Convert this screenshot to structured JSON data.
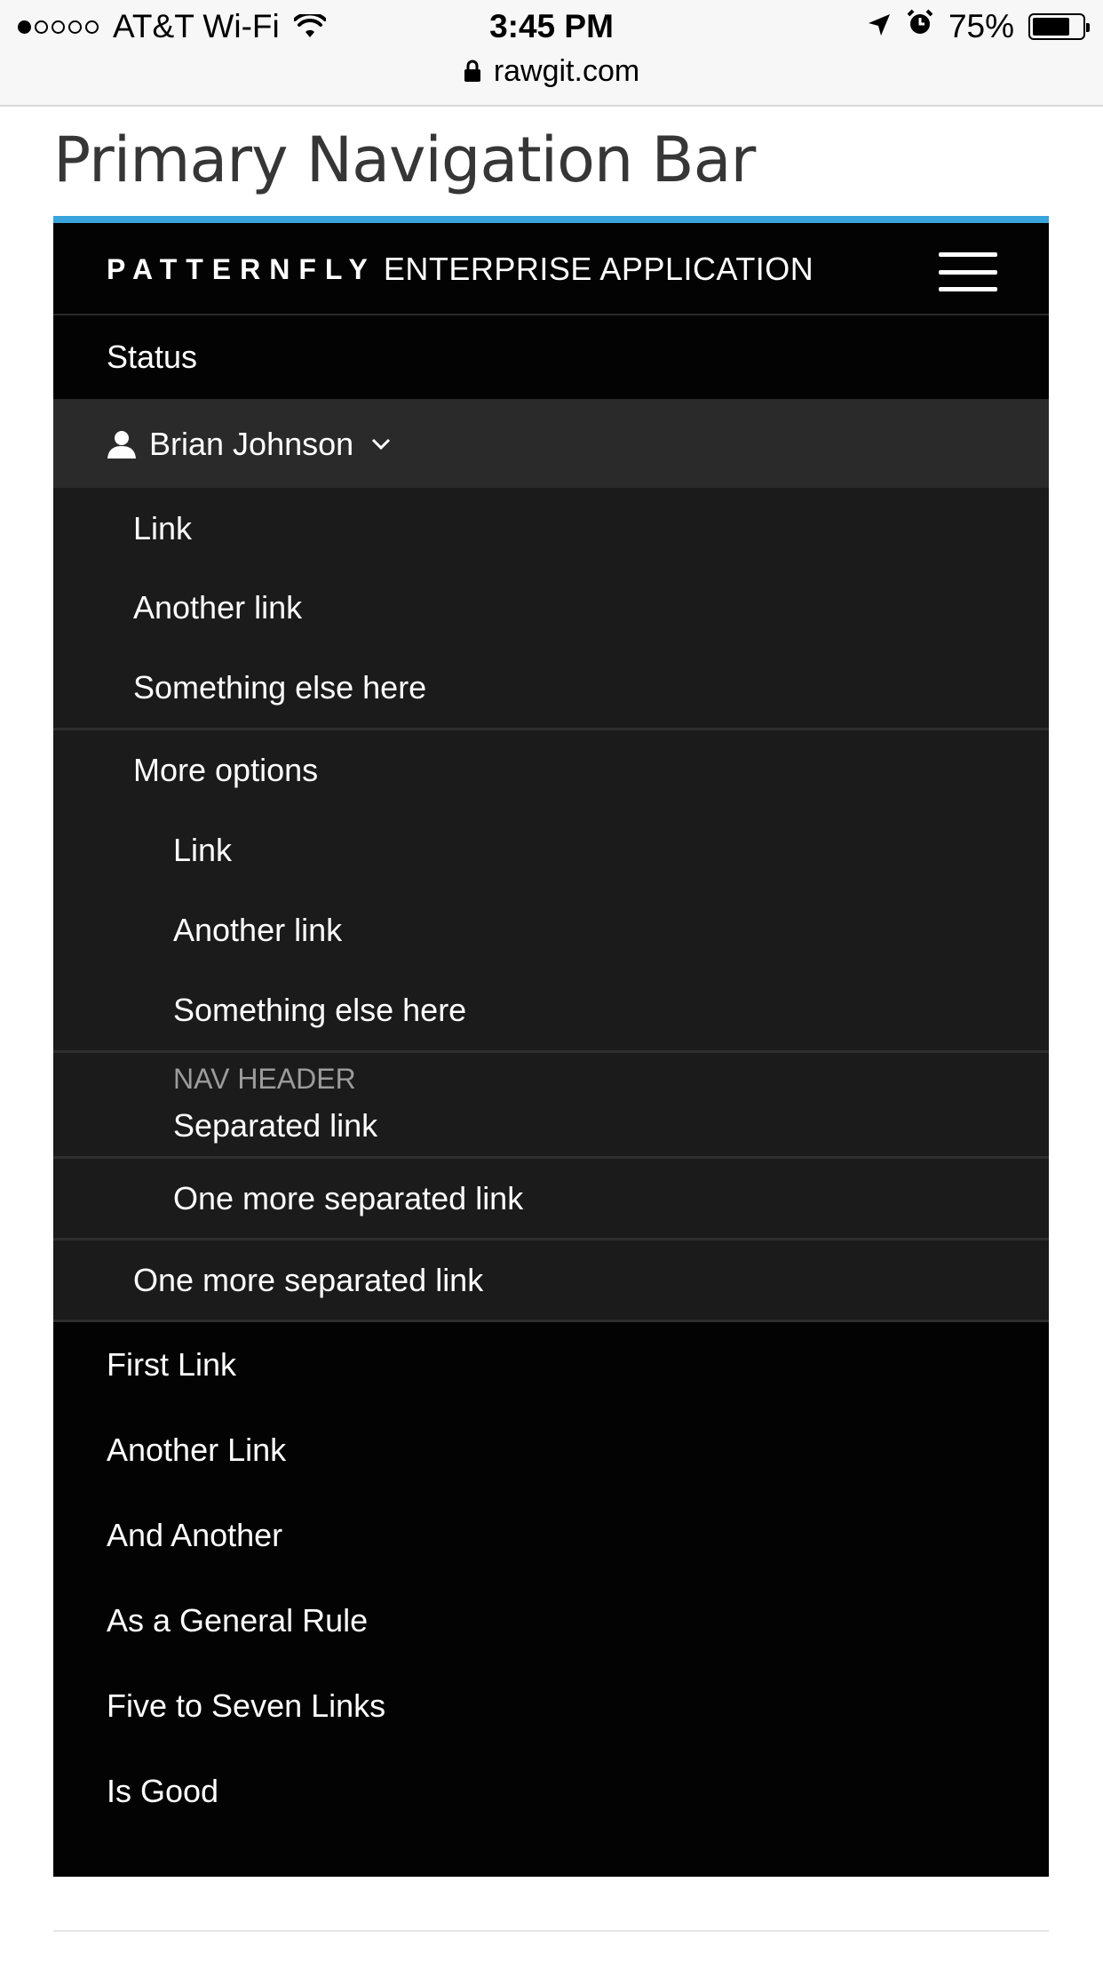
{
  "status_bar": {
    "carrier": "AT&T Wi-Fi",
    "time": "3:45 PM",
    "battery": "75%",
    "battery_level": 0.75,
    "url": "rawgit.com"
  },
  "page": {
    "title": "Primary Navigation Bar"
  },
  "navbar": {
    "brand_name": "PATTERNFLY",
    "brand_app": "ENTERPRISE APPLICATION",
    "accent_color": "#39a5dc",
    "status_label": "Status",
    "user_label": "Brian Johnson",
    "dropdown": {
      "items": [
        "Link",
        "Another link",
        "Something else here"
      ],
      "submenu_label": "More options",
      "submenu_items": [
        "Link",
        "Another link",
        "Something else here"
      ],
      "nav_header": "NAV HEADER",
      "separated_link": "Separated link",
      "submenu_more_link": "One more separated link",
      "more_link": "One more separated link"
    },
    "primary_links": [
      "First Link",
      "Another Link",
      "And Another",
      "As a General Rule",
      "Five to Seven Links",
      "Is Good"
    ]
  }
}
